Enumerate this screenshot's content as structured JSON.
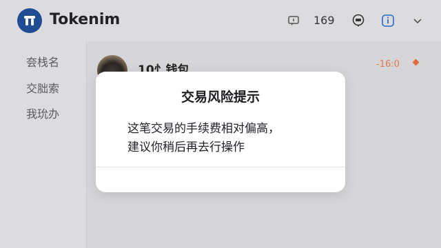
{
  "app": {
    "title": "Tokenim"
  },
  "header": {
    "number_text": "169"
  },
  "sidebar": {
    "items": [
      {
        "label": "夽栈名"
      },
      {
        "label": "交胐索"
      },
      {
        "label": "我玧办"
      }
    ]
  },
  "wallet_row": {
    "name": "10忄钱包",
    "amount": "-16:0"
  },
  "modal": {
    "title": "交易风险提示",
    "line1": "这笔交易的手续费相对偏高，",
    "line2": "建议你稍后再去行操作"
  },
  "colors": {
    "brand": "#1f4c92",
    "accent_orange": "#e06a3f",
    "background": "#d9d9db"
  }
}
